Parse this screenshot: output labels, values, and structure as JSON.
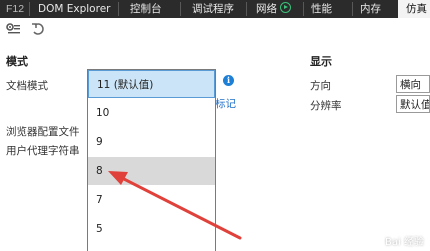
{
  "tabs": [
    {
      "label": "F12"
    },
    {
      "label": "DOM Explorer"
    },
    {
      "label": "控制台"
    },
    {
      "label": "调试程序"
    },
    {
      "label": "网络"
    },
    {
      "label": "性能"
    },
    {
      "label": "内存"
    },
    {
      "label": "仿真"
    }
  ],
  "toolbar": {
    "icons": [
      "settings-list-icon",
      "undo-icon"
    ]
  },
  "mode": {
    "heading": "模式",
    "document_mode_label": "文档模式",
    "browser_profile_label": "浏览器配置文件",
    "user_agent_label": "用户代理字符串",
    "link_text": "n 标记",
    "dropdown": {
      "options": [
        "11 (默认值)",
        "10",
        "9",
        "8",
        "7",
        "5"
      ],
      "selected": "11 (默认值)",
      "hovered": "8"
    }
  },
  "display": {
    "heading": "显示",
    "orientation_label": "方向",
    "orientation_value": "横向",
    "resolution_label": "分辨率",
    "resolution_value": "默认值"
  },
  "colors": {
    "tabbar_bg": "#2b2b2b",
    "selected_bg": "#cce4f7",
    "hover_bg": "#d9d9d9",
    "arrow": "#e0413a",
    "link": "#1e6fc8"
  },
  "watermark": "Bai 经验"
}
